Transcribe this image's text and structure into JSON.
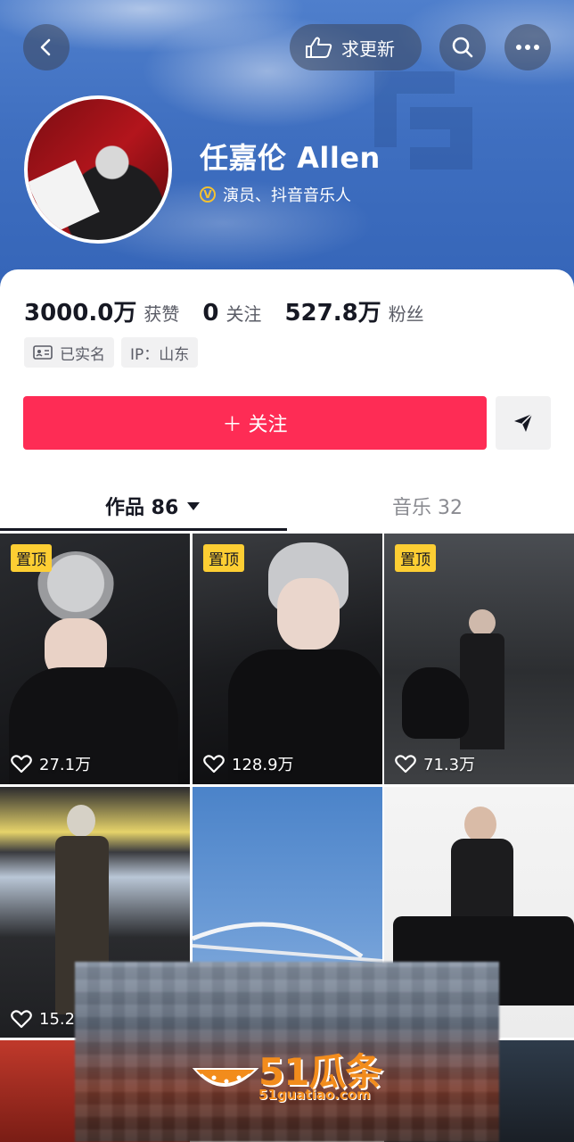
{
  "header": {
    "request_update_label": "求更新"
  },
  "profile": {
    "name": "任嘉伦 Allen",
    "verification": "演员、抖音音乐人"
  },
  "stats": [
    {
      "value": "3000.0万",
      "label": "获赞"
    },
    {
      "value": "0",
      "label": "关注"
    },
    {
      "value": "527.8万",
      "label": "粉丝"
    }
  ],
  "tags": [
    {
      "icon": "id-card-icon",
      "label": "已实名"
    },
    {
      "label": "IP：山东"
    }
  ],
  "actions": {
    "follow_label": "＋ 关注"
  },
  "tabs": [
    {
      "label": "作品 86",
      "active": true
    },
    {
      "label": "音乐 32",
      "active": false
    }
  ],
  "videos": [
    {
      "pinned": "置顶",
      "likes": "27.1万"
    },
    {
      "pinned": "置顶",
      "likes": "128.9万"
    },
    {
      "pinned": "置顶",
      "likes": "71.3万"
    },
    {
      "pinned": "",
      "likes": "15.2"
    },
    {
      "pinned": "",
      "likes": ""
    },
    {
      "pinned": "",
      "likes": ""
    }
  ],
  "watermark": {
    "brand": "51瓜条",
    "url": "51guatiao.com"
  },
  "colors": {
    "follow_button": "#fe2c55",
    "pin_badge": "#fdce33",
    "verify_badge": "#f5c230"
  }
}
